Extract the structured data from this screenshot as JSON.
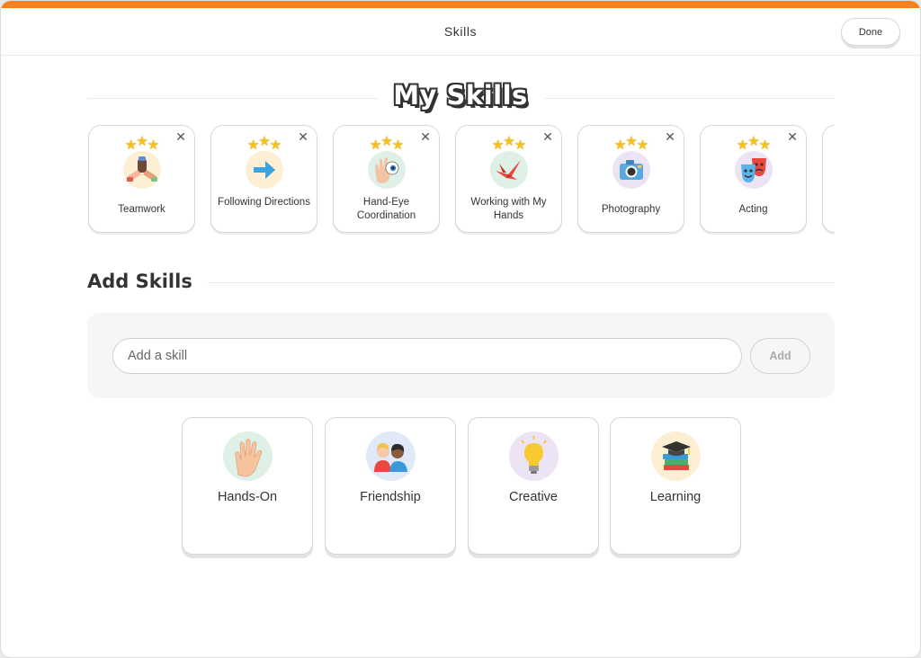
{
  "header": {
    "title": "Skills",
    "done_label": "Done"
  },
  "my_skills": {
    "heading": "My Skills",
    "items": [
      {
        "label": "Teamwork",
        "icon": "teamwork-hands-icon",
        "icon_bg": "#fcefd4"
      },
      {
        "label": "Following Directions",
        "icon": "arrow-right-icon",
        "icon_bg": "#fcefd4"
      },
      {
        "label": "Hand-Eye Coordination",
        "icon": "hand-eye-icon",
        "icon_bg": "#dff1e7"
      },
      {
        "label": "Working with My Hands",
        "icon": "paper-crane-icon",
        "icon_bg": "#dff1e7"
      },
      {
        "label": "Photography",
        "icon": "camera-icon",
        "icon_bg": "#ece3f5"
      },
      {
        "label": "Acting",
        "icon": "theater-masks-icon",
        "icon_bg": "#ece3f5"
      }
    ]
  },
  "add_skills": {
    "heading": "Add Skills",
    "input_placeholder": "Add a skill",
    "add_label": "Add",
    "categories": [
      {
        "label": "Hands-On",
        "icon": "raised-hand-icon",
        "icon_bg": "#dff1e7"
      },
      {
        "label": "Friendship",
        "icon": "friends-icon",
        "icon_bg": "#dfe9f7"
      },
      {
        "label": "Creative",
        "icon": "lightbulb-icon",
        "icon_bg": "#ece3f5"
      },
      {
        "label": "Learning",
        "icon": "books-graduation-cap-icon",
        "icon_bg": "#fcefd4"
      }
    ]
  },
  "colors": {
    "accent": "#f5821f",
    "star": "#f5c21a"
  }
}
